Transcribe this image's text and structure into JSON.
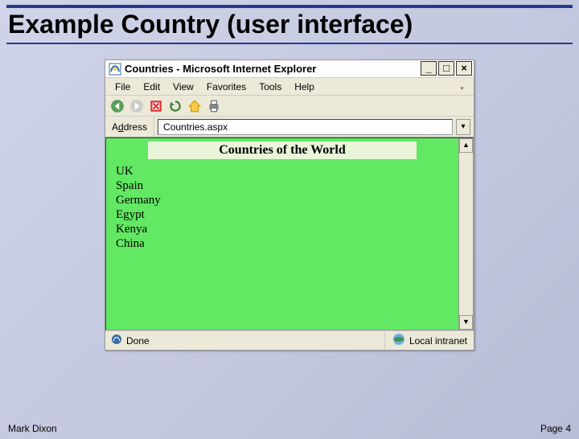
{
  "slide": {
    "title": "Example Country (user interface)",
    "author": "Mark Dixon",
    "page": "Page 4"
  },
  "window": {
    "title": "Countries - Microsoft Internet Explorer",
    "controls": {
      "min": "_",
      "max": "□",
      "close": "×"
    }
  },
  "menu": {
    "file": "File",
    "edit": "Edit",
    "view": "View",
    "favorites": "Favorites",
    "tools": "Tools",
    "help": "Help"
  },
  "addressbar": {
    "label": "Address",
    "value": "Countries.aspx",
    "dropdown": "▾"
  },
  "page": {
    "heading": "Countries of the World",
    "countries": [
      "UK",
      "Spain",
      "Germany",
      "Egypt",
      "Kenya",
      "China"
    ]
  },
  "status": {
    "done": "Done",
    "zone": "Local intranet"
  },
  "scroll": {
    "up": "▲",
    "down": "▼"
  }
}
